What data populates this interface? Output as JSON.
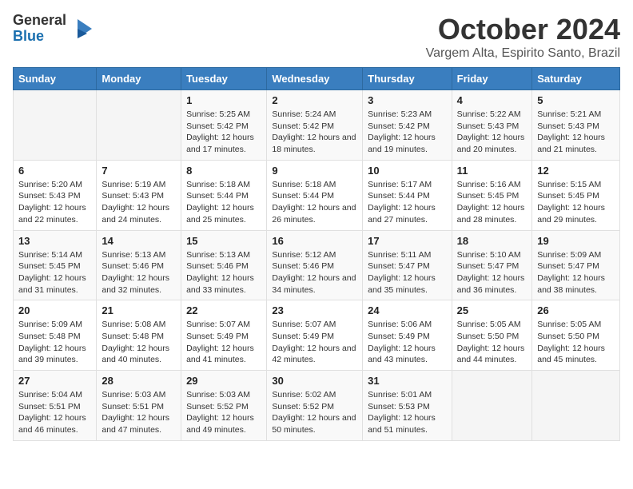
{
  "logo": {
    "text1": "General",
    "text2": "Blue"
  },
  "title": "October 2024",
  "subtitle": "Vargem Alta, Espirito Santo, Brazil",
  "days_of_week": [
    "Sunday",
    "Monday",
    "Tuesday",
    "Wednesday",
    "Thursday",
    "Friday",
    "Saturday"
  ],
  "weeks": [
    [
      {
        "day": "",
        "sunrise": "",
        "sunset": "",
        "daylight": ""
      },
      {
        "day": "",
        "sunrise": "",
        "sunset": "",
        "daylight": ""
      },
      {
        "day": "1",
        "sunrise": "Sunrise: 5:25 AM",
        "sunset": "Sunset: 5:42 PM",
        "daylight": "Daylight: 12 hours and 17 minutes."
      },
      {
        "day": "2",
        "sunrise": "Sunrise: 5:24 AM",
        "sunset": "Sunset: 5:42 PM",
        "daylight": "Daylight: 12 hours and 18 minutes."
      },
      {
        "day": "3",
        "sunrise": "Sunrise: 5:23 AM",
        "sunset": "Sunset: 5:42 PM",
        "daylight": "Daylight: 12 hours and 19 minutes."
      },
      {
        "day": "4",
        "sunrise": "Sunrise: 5:22 AM",
        "sunset": "Sunset: 5:43 PM",
        "daylight": "Daylight: 12 hours and 20 minutes."
      },
      {
        "day": "5",
        "sunrise": "Sunrise: 5:21 AM",
        "sunset": "Sunset: 5:43 PM",
        "daylight": "Daylight: 12 hours and 21 minutes."
      }
    ],
    [
      {
        "day": "6",
        "sunrise": "Sunrise: 5:20 AM",
        "sunset": "Sunset: 5:43 PM",
        "daylight": "Daylight: 12 hours and 22 minutes."
      },
      {
        "day": "7",
        "sunrise": "Sunrise: 5:19 AM",
        "sunset": "Sunset: 5:43 PM",
        "daylight": "Daylight: 12 hours and 24 minutes."
      },
      {
        "day": "8",
        "sunrise": "Sunrise: 5:18 AM",
        "sunset": "Sunset: 5:44 PM",
        "daylight": "Daylight: 12 hours and 25 minutes."
      },
      {
        "day": "9",
        "sunrise": "Sunrise: 5:18 AM",
        "sunset": "Sunset: 5:44 PM",
        "daylight": "Daylight: 12 hours and 26 minutes."
      },
      {
        "day": "10",
        "sunrise": "Sunrise: 5:17 AM",
        "sunset": "Sunset: 5:44 PM",
        "daylight": "Daylight: 12 hours and 27 minutes."
      },
      {
        "day": "11",
        "sunrise": "Sunrise: 5:16 AM",
        "sunset": "Sunset: 5:45 PM",
        "daylight": "Daylight: 12 hours and 28 minutes."
      },
      {
        "day": "12",
        "sunrise": "Sunrise: 5:15 AM",
        "sunset": "Sunset: 5:45 PM",
        "daylight": "Daylight: 12 hours and 29 minutes."
      }
    ],
    [
      {
        "day": "13",
        "sunrise": "Sunrise: 5:14 AM",
        "sunset": "Sunset: 5:45 PM",
        "daylight": "Daylight: 12 hours and 31 minutes."
      },
      {
        "day": "14",
        "sunrise": "Sunrise: 5:13 AM",
        "sunset": "Sunset: 5:46 PM",
        "daylight": "Daylight: 12 hours and 32 minutes."
      },
      {
        "day": "15",
        "sunrise": "Sunrise: 5:13 AM",
        "sunset": "Sunset: 5:46 PM",
        "daylight": "Daylight: 12 hours and 33 minutes."
      },
      {
        "day": "16",
        "sunrise": "Sunrise: 5:12 AM",
        "sunset": "Sunset: 5:46 PM",
        "daylight": "Daylight: 12 hours and 34 minutes."
      },
      {
        "day": "17",
        "sunrise": "Sunrise: 5:11 AM",
        "sunset": "Sunset: 5:47 PM",
        "daylight": "Daylight: 12 hours and 35 minutes."
      },
      {
        "day": "18",
        "sunrise": "Sunrise: 5:10 AM",
        "sunset": "Sunset: 5:47 PM",
        "daylight": "Daylight: 12 hours and 36 minutes."
      },
      {
        "day": "19",
        "sunrise": "Sunrise: 5:09 AM",
        "sunset": "Sunset: 5:47 PM",
        "daylight": "Daylight: 12 hours and 38 minutes."
      }
    ],
    [
      {
        "day": "20",
        "sunrise": "Sunrise: 5:09 AM",
        "sunset": "Sunset: 5:48 PM",
        "daylight": "Daylight: 12 hours and 39 minutes."
      },
      {
        "day": "21",
        "sunrise": "Sunrise: 5:08 AM",
        "sunset": "Sunset: 5:48 PM",
        "daylight": "Daylight: 12 hours and 40 minutes."
      },
      {
        "day": "22",
        "sunrise": "Sunrise: 5:07 AM",
        "sunset": "Sunset: 5:49 PM",
        "daylight": "Daylight: 12 hours and 41 minutes."
      },
      {
        "day": "23",
        "sunrise": "Sunrise: 5:07 AM",
        "sunset": "Sunset: 5:49 PM",
        "daylight": "Daylight: 12 hours and 42 minutes."
      },
      {
        "day": "24",
        "sunrise": "Sunrise: 5:06 AM",
        "sunset": "Sunset: 5:49 PM",
        "daylight": "Daylight: 12 hours and 43 minutes."
      },
      {
        "day": "25",
        "sunrise": "Sunrise: 5:05 AM",
        "sunset": "Sunset: 5:50 PM",
        "daylight": "Daylight: 12 hours and 44 minutes."
      },
      {
        "day": "26",
        "sunrise": "Sunrise: 5:05 AM",
        "sunset": "Sunset: 5:50 PM",
        "daylight": "Daylight: 12 hours and 45 minutes."
      }
    ],
    [
      {
        "day": "27",
        "sunrise": "Sunrise: 5:04 AM",
        "sunset": "Sunset: 5:51 PM",
        "daylight": "Daylight: 12 hours and 46 minutes."
      },
      {
        "day": "28",
        "sunrise": "Sunrise: 5:03 AM",
        "sunset": "Sunset: 5:51 PM",
        "daylight": "Daylight: 12 hours and 47 minutes."
      },
      {
        "day": "29",
        "sunrise": "Sunrise: 5:03 AM",
        "sunset": "Sunset: 5:52 PM",
        "daylight": "Daylight: 12 hours and 49 minutes."
      },
      {
        "day": "30",
        "sunrise": "Sunrise: 5:02 AM",
        "sunset": "Sunset: 5:52 PM",
        "daylight": "Daylight: 12 hours and 50 minutes."
      },
      {
        "day": "31",
        "sunrise": "Sunrise: 5:01 AM",
        "sunset": "Sunset: 5:53 PM",
        "daylight": "Daylight: 12 hours and 51 minutes."
      },
      {
        "day": "",
        "sunrise": "",
        "sunset": "",
        "daylight": ""
      },
      {
        "day": "",
        "sunrise": "",
        "sunset": "",
        "daylight": ""
      }
    ]
  ]
}
